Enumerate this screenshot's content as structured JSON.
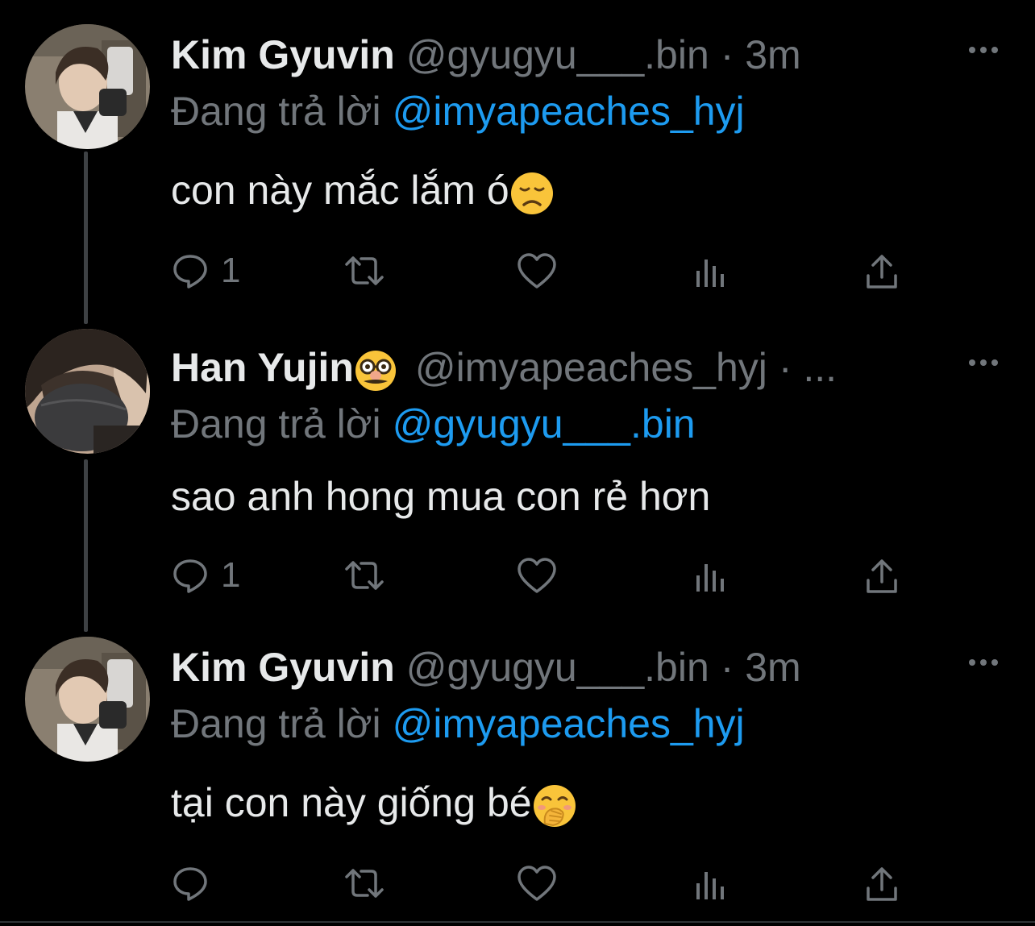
{
  "tweets": [
    {
      "name": "Kim Gyuvin",
      "handle": "@gyugyu___.bin",
      "separator": "·",
      "time": "3m",
      "reply_prefix": "Đang trả lời",
      "reply_to": "@imyapeaches_hyj",
      "text": "con này mắc lắm ó",
      "text_emoji": "disappointed-face-emoji",
      "reply_count": "1",
      "avatar": "kim-gyuvin-avatar"
    },
    {
      "name": "Han Yujin",
      "name_emoji": "disguised-face-emoji",
      "handle": "@imyapeaches_hyj",
      "separator": "·",
      "time": "...",
      "reply_prefix": "Đang trả lời",
      "reply_to": "@gyugyu___.bin",
      "text": "sao anh hong mua con rẻ hơn",
      "reply_count": "1",
      "avatar": "han-yujin-avatar"
    },
    {
      "name": "Kim Gyuvin",
      "handle": "@gyugyu___.bin",
      "separator": "·",
      "time": "3m",
      "reply_prefix": "Đang trả lời",
      "reply_to": "@imyapeaches_hyj",
      "text": "tại con này giống bé",
      "text_emoji": "face-with-hand-over-mouth-emoji",
      "reply_count": "",
      "avatar": "kim-gyuvin-avatar"
    }
  ],
  "icons": {
    "reply": "reply-icon",
    "retweet": "retweet-icon",
    "like": "like-icon",
    "views": "views-icon",
    "share": "share-icon",
    "more": "more-icon"
  },
  "colors": {
    "background": "#000000",
    "primary_text": "#e7e9ea",
    "secondary_text": "#71767b",
    "mention": "#1d9bf0",
    "thread_line": "#3e4144"
  }
}
